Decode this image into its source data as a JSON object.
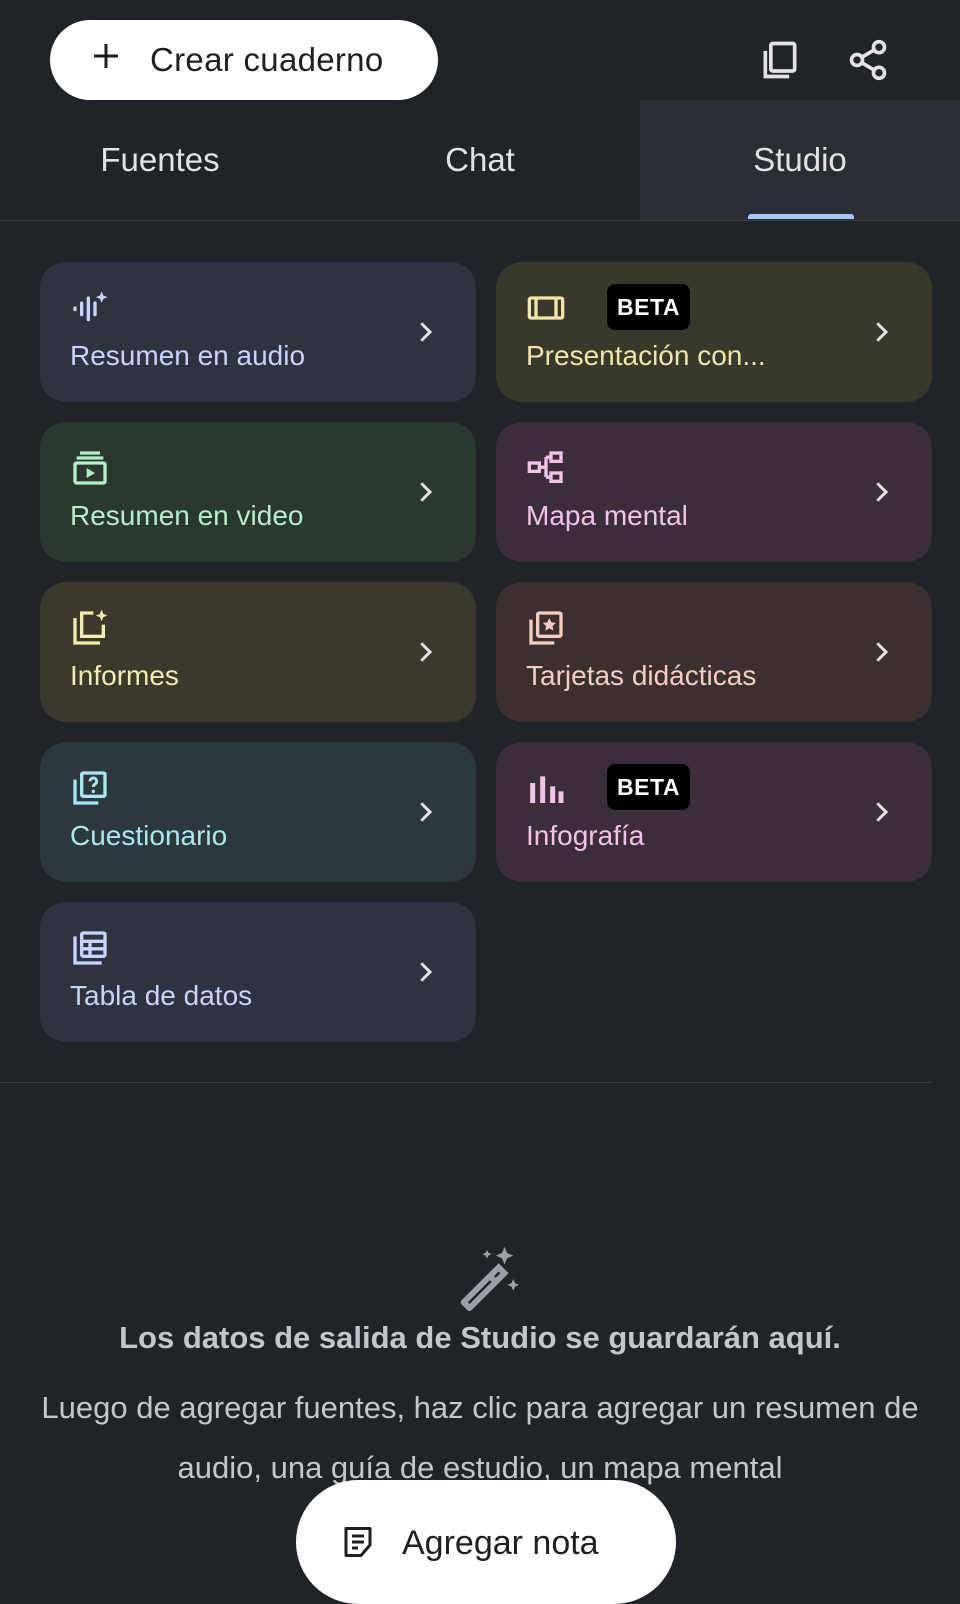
{
  "header": {
    "create_label": "Crear cuaderno",
    "icons": [
      "plus-icon",
      "copy-icon",
      "share-icon"
    ]
  },
  "tabs": [
    {
      "label": "Fuentes",
      "active": false
    },
    {
      "label": "Chat",
      "active": false
    },
    {
      "label": "Studio",
      "active": true
    }
  ],
  "studio_cards": [
    {
      "label": "Resumen en audio",
      "icon": "audio-waveform-sparkle-icon",
      "beta": false,
      "bg": "#2e333f",
      "fg": "#c7d4ff"
    },
    {
      "label": "Presentación con...",
      "icon": "slides-icon",
      "beta": true,
      "badge": "BETA",
      "bg": "#38382b",
      "fg": "#efe8a8"
    },
    {
      "label": "Resumen en video",
      "icon": "video-summary-icon",
      "beta": false,
      "bg": "#2b382f",
      "fg": "#b3efc7"
    },
    {
      "label": "Mapa mental",
      "icon": "mind-map-icon",
      "beta": false,
      "bg": "#3b2e3a",
      "fg": "#f2c2ea"
    },
    {
      "label": "Informes",
      "icon": "reports-sparkle-icon",
      "beta": false,
      "bg": "#3a392c",
      "fg": "#f2ecb0"
    },
    {
      "label": "Tarjetas didácticas",
      "icon": "flashcards-icon",
      "beta": false,
      "bg": "#3b302f",
      "fg": "#f7cdc2"
    },
    {
      "label": "Cuestionario",
      "icon": "quiz-icon",
      "beta": false,
      "bg": "#2d373e",
      "fg": "#a8e8ef"
    },
    {
      "label": "Infografía",
      "icon": "infographic-icon",
      "beta": true,
      "badge": "BETA",
      "bg": "#3b2e3a",
      "fg": "#f2c2ea"
    },
    {
      "label": "Tabla de datos",
      "icon": "data-table-icon",
      "beta": false,
      "bg": "#2e333f",
      "fg": "#c7d4ff"
    }
  ],
  "empty_state": {
    "icon": "magic-wand-icon",
    "title": "Los datos de salida de Studio se guardarán aquí.",
    "body": "Luego de agregar fuentes, haz clic para agregar un resumen de audio, una guía de estudio, un mapa mental"
  },
  "footer": {
    "add_note_label": "Agregar nota",
    "icon": "note-icon"
  }
}
